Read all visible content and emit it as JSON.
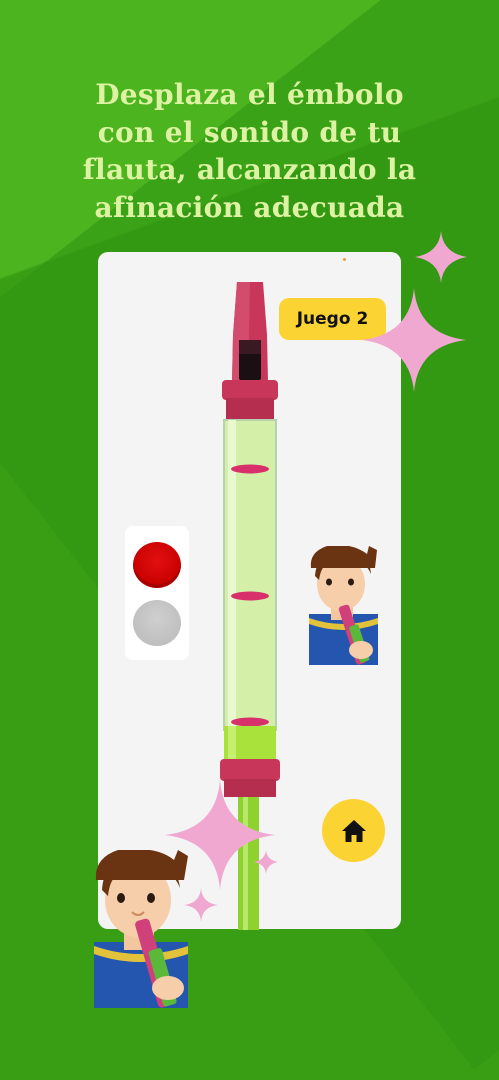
{
  "headline": {
    "line1": "Desplaza el émbolo",
    "line2": "con el sonido de tu",
    "line3": "flauta, alcanzando la",
    "line4": "afinación adecuada"
  },
  "game": {
    "level_label": "Juego 2"
  },
  "icons": {
    "home": "home-icon",
    "sparkle": "sparkle-icon"
  },
  "indicators": {
    "top": "red",
    "bottom": "gray"
  },
  "colors": {
    "background": "#3fa818",
    "headline": "#ddf3a3",
    "badge": "#fbd434",
    "flute": "#c8365a",
    "tube": "#d4f0a8",
    "sparkle": "#f0a8d0"
  }
}
